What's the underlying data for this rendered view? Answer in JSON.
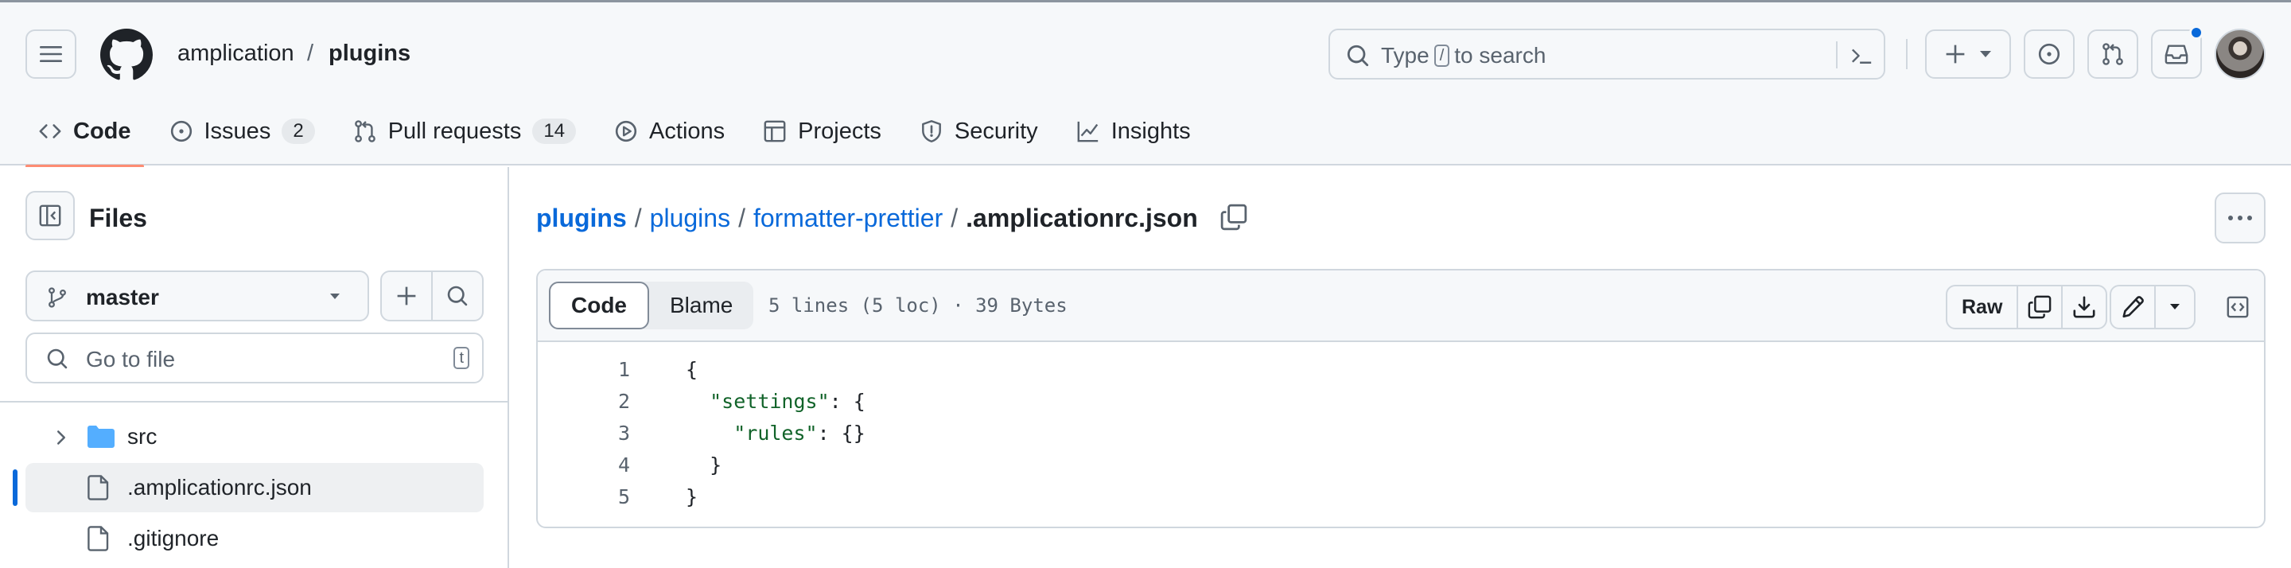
{
  "header": {
    "owner": "amplication",
    "separator": "/",
    "repo": "plugins",
    "search": {
      "prefix": "Type",
      "key": "/",
      "suffix": "to search"
    },
    "icons": [
      "hamburger-icon",
      "github-logo-icon",
      "search-icon",
      "command-palette-icon",
      "plus-icon",
      "issues-icon",
      "pull-requests-icon",
      "inbox-icon"
    ]
  },
  "repo_tabs": [
    {
      "label": "Code",
      "icon": "code-icon",
      "selected": true
    },
    {
      "label": "Issues",
      "icon": "issue-icon",
      "count": "2"
    },
    {
      "label": "Pull requests",
      "icon": "pull-request-icon",
      "count": "14"
    },
    {
      "label": "Actions",
      "icon": "play-icon"
    },
    {
      "label": "Projects",
      "icon": "table-icon"
    },
    {
      "label": "Security",
      "icon": "shield-icon"
    },
    {
      "label": "Insights",
      "icon": "graph-icon"
    }
  ],
  "sidebar": {
    "title": "Files",
    "branch": "master",
    "goto_placeholder": "Go to file",
    "goto_key": "t",
    "tree": [
      {
        "label": "src",
        "type": "folder"
      },
      {
        "label": ".amplicationrc.json",
        "type": "file",
        "active": true
      },
      {
        "label": ".gitignore",
        "type": "file"
      }
    ]
  },
  "breadcrumb": {
    "parts": [
      "plugins",
      "plugins",
      "formatter-prettier"
    ],
    "current": ".amplicationrc.json",
    "sep": "/"
  },
  "file": {
    "tabs": [
      "Code",
      "Blame"
    ],
    "meta": "5 lines (5 loc) · 39 Bytes",
    "raw_label": "Raw",
    "lines": [
      {
        "n": "1",
        "text": "{"
      },
      {
        "n": "2",
        "indent": "  ",
        "key": "\"settings\"",
        "rest": ": {"
      },
      {
        "n": "3",
        "indent": "    ",
        "key": "\"rules\"",
        "rest": ": {}"
      },
      {
        "n": "4",
        "text": "  }"
      },
      {
        "n": "5",
        "text": "}"
      }
    ]
  },
  "colors": {
    "accent": "#0969da",
    "tab_underline": "#fd8c73",
    "border": "#d0d7de",
    "canvas_subtle": "#f6f8fa"
  }
}
